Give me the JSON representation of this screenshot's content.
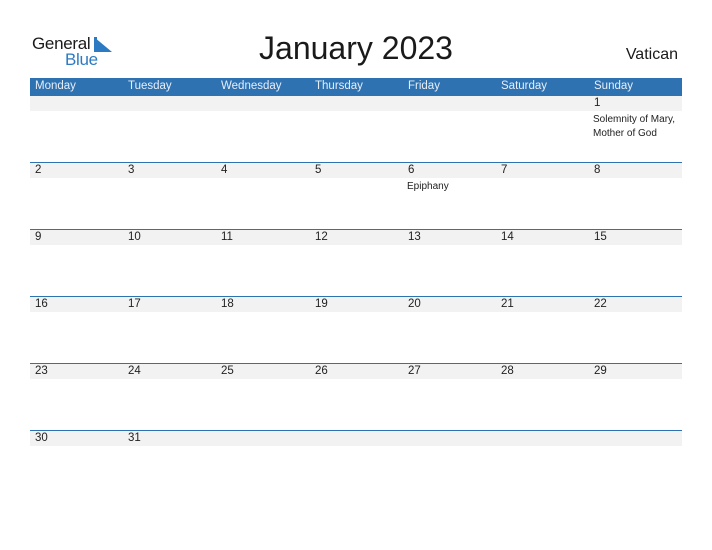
{
  "logo": {
    "general": "General",
    "blue": "Blue",
    "icon": "triangle-flag-icon"
  },
  "title": "January 2023",
  "country": "Vatican",
  "colors": {
    "accent": "#2f72b2",
    "band": "#f2f2f2",
    "logo_blue": "#2c7bc2"
  },
  "weekdays": [
    "Monday",
    "Tuesday",
    "Wednesday",
    "Thursday",
    "Friday",
    "Saturday",
    "Sunday"
  ],
  "weeks": [
    [
      {
        "day": "",
        "event": ""
      },
      {
        "day": "",
        "event": ""
      },
      {
        "day": "",
        "event": ""
      },
      {
        "day": "",
        "event": ""
      },
      {
        "day": "",
        "event": ""
      },
      {
        "day": "",
        "event": ""
      },
      {
        "day": "1",
        "event": "Solemnity of Mary, Mother of God"
      }
    ],
    [
      {
        "day": "2",
        "event": ""
      },
      {
        "day": "3",
        "event": ""
      },
      {
        "day": "4",
        "event": ""
      },
      {
        "day": "5",
        "event": ""
      },
      {
        "day": "6",
        "event": "Epiphany"
      },
      {
        "day": "7",
        "event": ""
      },
      {
        "day": "8",
        "event": ""
      }
    ],
    [
      {
        "day": "9",
        "event": ""
      },
      {
        "day": "10",
        "event": ""
      },
      {
        "day": "11",
        "event": ""
      },
      {
        "day": "12",
        "event": ""
      },
      {
        "day": "13",
        "event": ""
      },
      {
        "day": "14",
        "event": ""
      },
      {
        "day": "15",
        "event": ""
      }
    ],
    [
      {
        "day": "16",
        "event": ""
      },
      {
        "day": "17",
        "event": ""
      },
      {
        "day": "18",
        "event": ""
      },
      {
        "day": "19",
        "event": ""
      },
      {
        "day": "20",
        "event": ""
      },
      {
        "day": "21",
        "event": ""
      },
      {
        "day": "22",
        "event": ""
      }
    ],
    [
      {
        "day": "23",
        "event": ""
      },
      {
        "day": "24",
        "event": ""
      },
      {
        "day": "25",
        "event": ""
      },
      {
        "day": "26",
        "event": ""
      },
      {
        "day": "27",
        "event": ""
      },
      {
        "day": "28",
        "event": ""
      },
      {
        "day": "29",
        "event": ""
      }
    ],
    [
      {
        "day": "30",
        "event": ""
      },
      {
        "day": "31",
        "event": ""
      },
      {
        "day": "",
        "event": ""
      },
      {
        "day": "",
        "event": ""
      },
      {
        "day": "",
        "event": ""
      },
      {
        "day": "",
        "event": ""
      },
      {
        "day": "",
        "event": ""
      }
    ]
  ]
}
